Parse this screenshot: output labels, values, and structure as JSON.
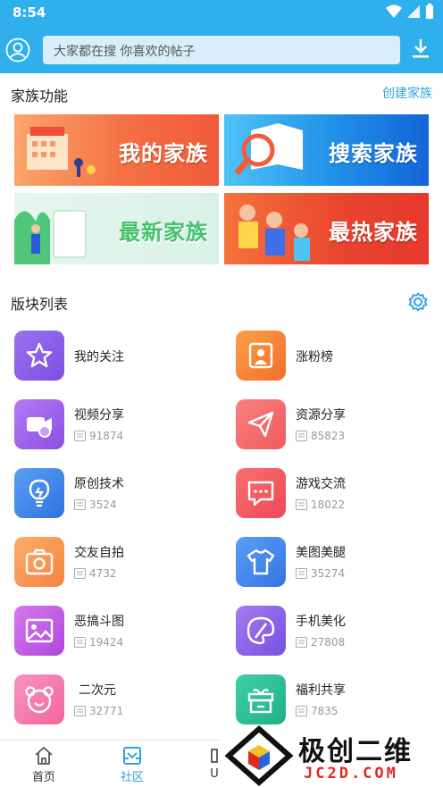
{
  "status": {
    "time": "8:54"
  },
  "header": {
    "search_placeholder": "大家都在搜  你喜欢的帖子"
  },
  "family": {
    "title": "家族功能",
    "create_label": "创建家族",
    "banners": [
      {
        "label": "我的家族"
      },
      {
        "label": "搜索家族"
      },
      {
        "label": "最新家族"
      },
      {
        "label": "最热家族"
      }
    ]
  },
  "boards": {
    "title": "版块列表",
    "items": [
      {
        "name": "我的关注",
        "count": "",
        "icon": "star-icon",
        "color": "#8a5fe6"
      },
      {
        "name": "涨粉榜",
        "count": "",
        "icon": "rank-icon",
        "color": "#f7853a"
      },
      {
        "name": "视频分享",
        "count": "91874",
        "icon": "video-icon",
        "color": "#a05de8"
      },
      {
        "name": "资源分享",
        "count": "85823",
        "icon": "send-icon",
        "color": "#f46b6b"
      },
      {
        "name": "原创技术",
        "count": "3524",
        "icon": "bulb-icon",
        "color": "#3f88e8"
      },
      {
        "name": "游戏交流",
        "count": "18022",
        "icon": "chat-icon",
        "color": "#f05b62"
      },
      {
        "name": "交友自拍",
        "count": "4732",
        "icon": "camera-icon",
        "color": "#f89a56"
      },
      {
        "name": "美图美腿",
        "count": "35274",
        "icon": "shirt-icon",
        "color": "#4b8ff0"
      },
      {
        "name": "恶搞斗图",
        "count": "19424",
        "icon": "image-icon",
        "color": "#c15fe0"
      },
      {
        "name": "手机美化",
        "count": "27808",
        "icon": "palette-icon",
        "color": "#9164e6"
      },
      {
        "name": "二次元",
        "count": "32771",
        "icon": "bear-icon",
        "color": "#f37db0"
      },
      {
        "name": "福利共享",
        "count": "7835",
        "icon": "gift-icon",
        "color": "#2fbf98"
      }
    ]
  },
  "nav": {
    "items": [
      {
        "label": "首页",
        "icon": "home-icon"
      },
      {
        "label": "社区",
        "icon": "community-icon"
      },
      {
        "label": "U",
        "icon": "user-icon"
      }
    ],
    "active_color": "#2fa3e0"
  },
  "watermark": {
    "main": "极创二维",
    "sub": "JC2D.COM"
  }
}
